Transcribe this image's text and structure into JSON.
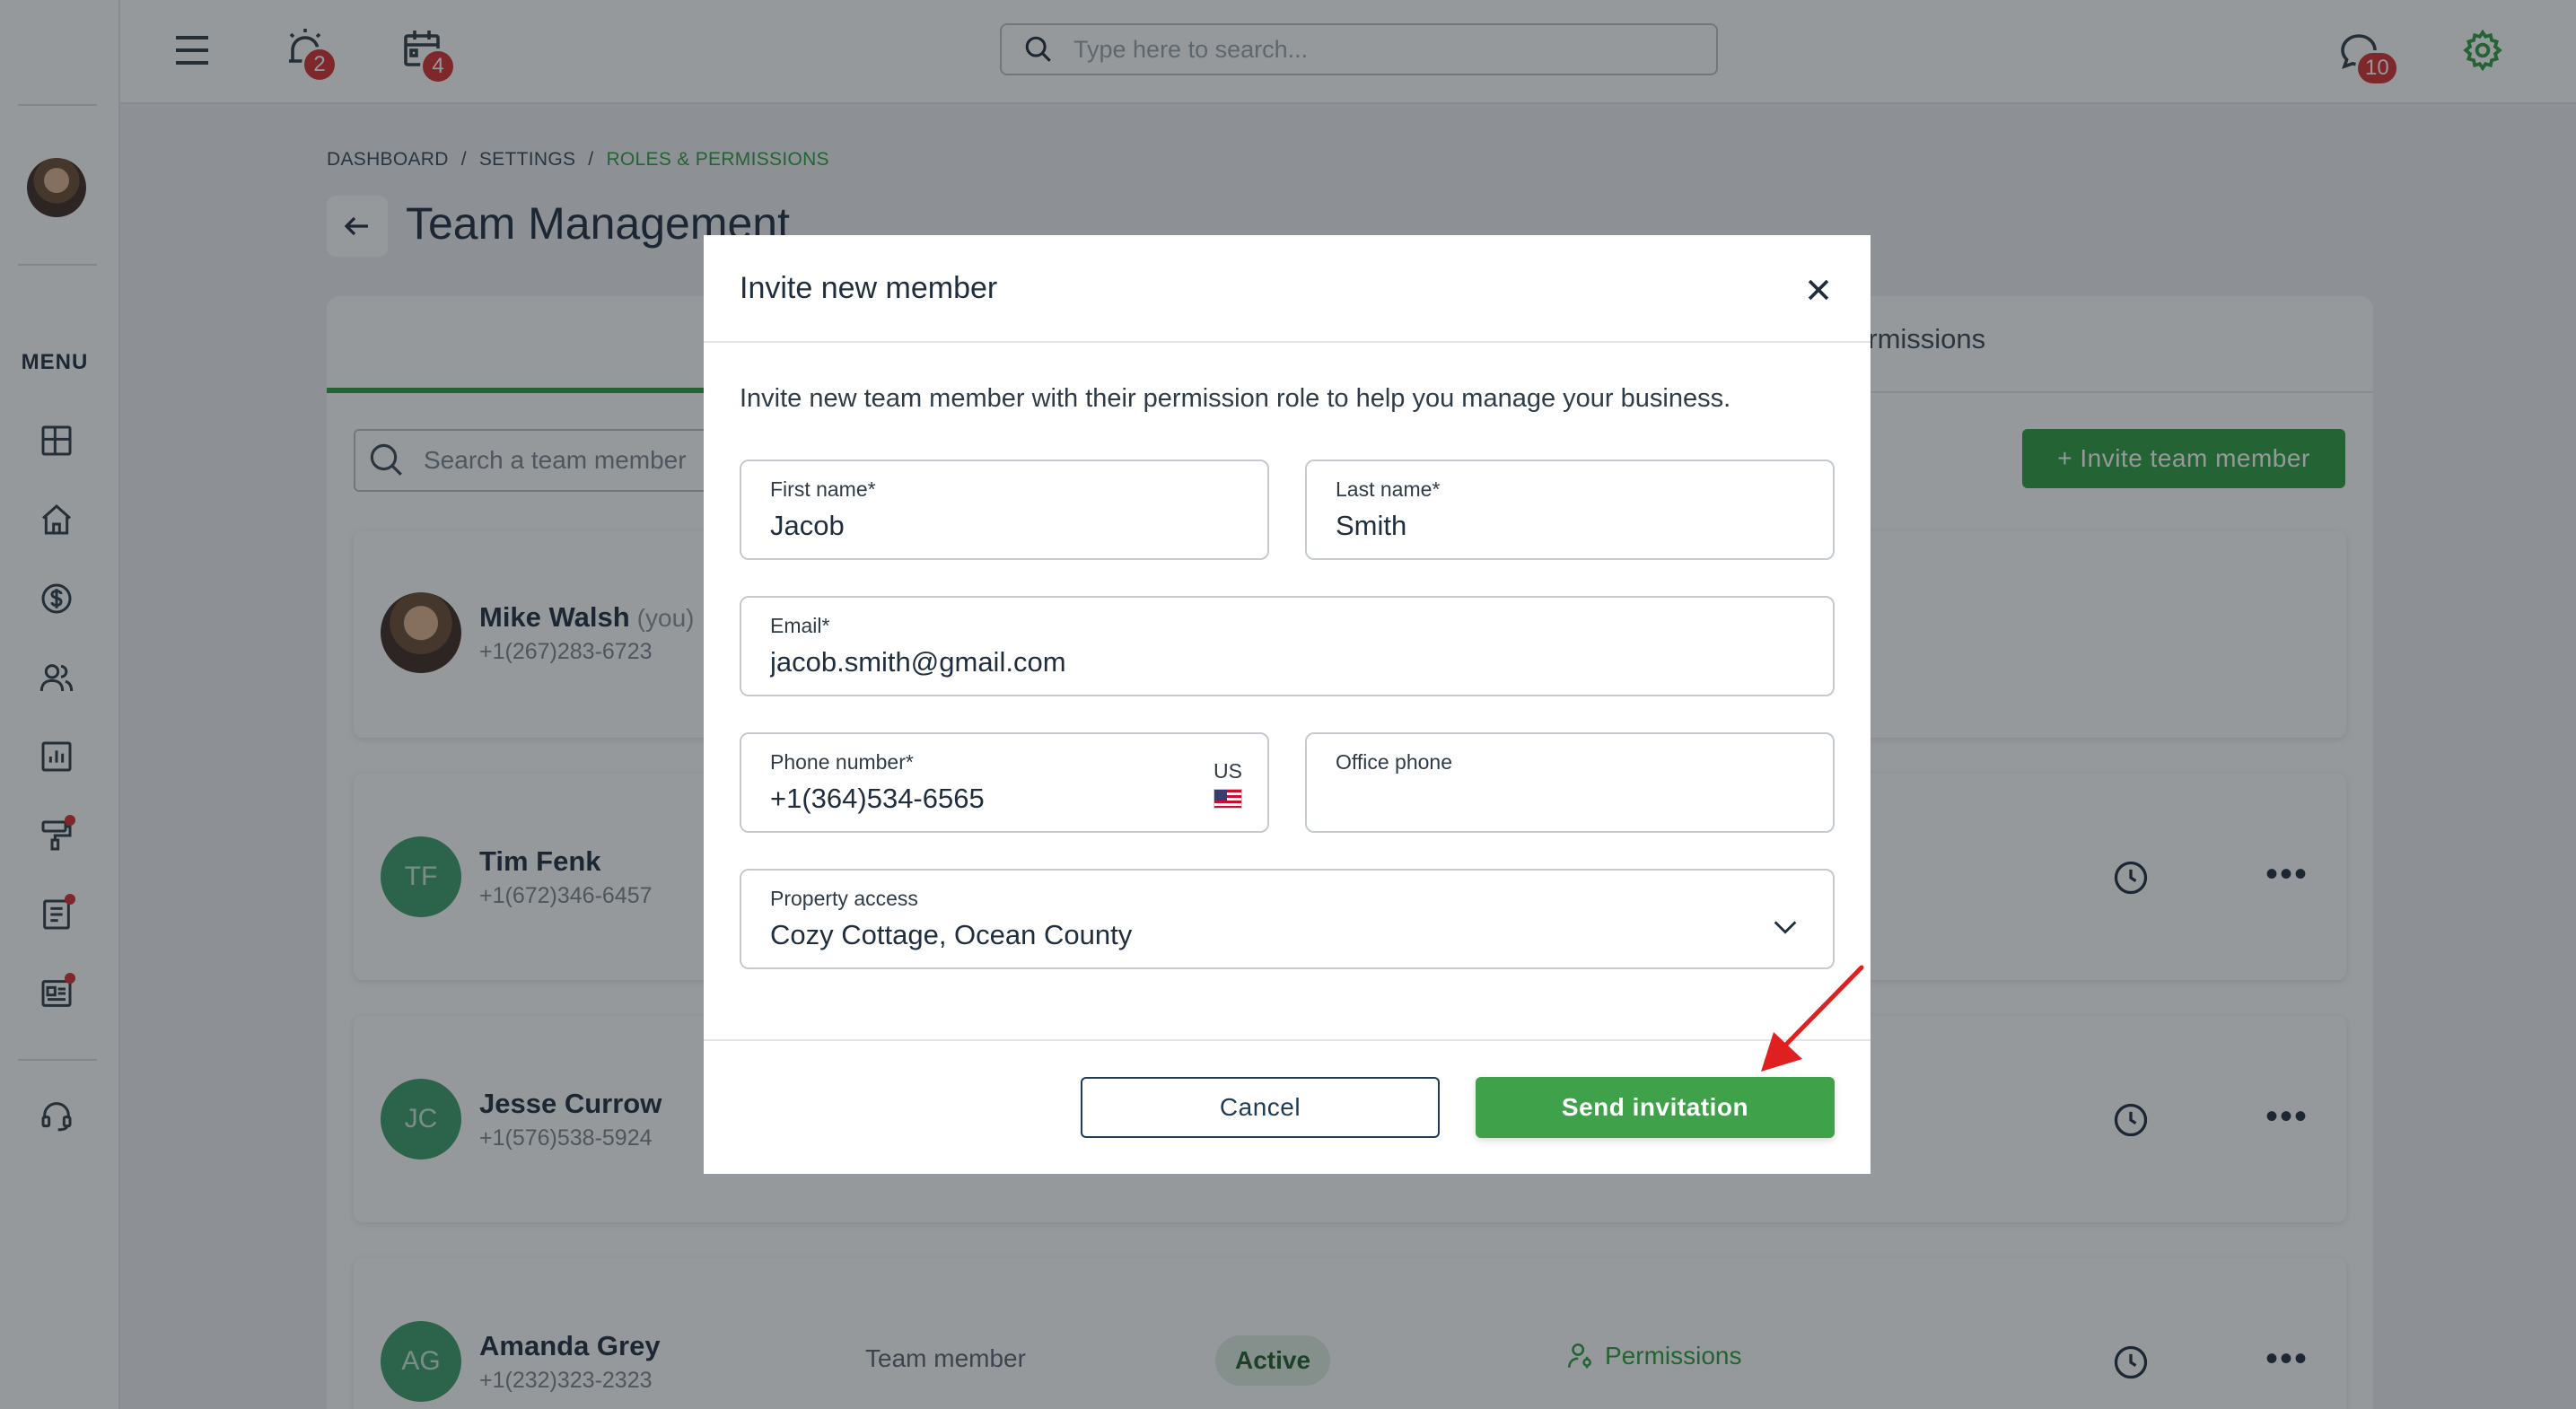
{
  "topbar": {
    "alerts_badge": "2",
    "calendar_badge": "4",
    "messages_badge": "10",
    "search_placeholder": "Type here to search..."
  },
  "sidebar": {
    "menu_label": "MENU",
    "items": [
      {
        "icon": "dashboard-icon"
      },
      {
        "icon": "home-icon"
      },
      {
        "icon": "dollar-icon"
      },
      {
        "icon": "users-icon"
      },
      {
        "icon": "reports-icon"
      },
      {
        "icon": "maintenance-icon",
        "notification_dot": true
      },
      {
        "icon": "document-icon",
        "notification_dot": true
      },
      {
        "icon": "listing-icon",
        "notification_dot": true
      },
      {
        "icon": "support-headset-icon"
      }
    ]
  },
  "breadcrumb": {
    "items": [
      "DASHBOARD",
      "SETTINGS",
      "ROLES & PERMISSIONS"
    ],
    "separator": "/"
  },
  "page": {
    "title": "Team Management",
    "tab_permissions_partial": "ermissions",
    "search_placeholder": "Search a team member",
    "invite_button": "+ Invite team member"
  },
  "members": [
    {
      "name": "Mike Walsh",
      "suffix": "(you)",
      "phone": "+1(267)283-6723",
      "initials": "",
      "photo": true
    },
    {
      "name": "Tim Fenk",
      "phone": "+1(672)346-6457",
      "initials": "TF"
    },
    {
      "name": "Jesse Currow",
      "phone": "+1(576)538-5924",
      "initials": "JC"
    },
    {
      "name": "Amanda Grey",
      "phone": "+1(232)323-2323",
      "initials": "AG",
      "role": "Team member",
      "status": "Active",
      "permissions_label": "Permissions"
    }
  ],
  "modal": {
    "title": "Invite new member",
    "description": "Invite new team member with their permission role to help you manage your business.",
    "fields": {
      "first_name": {
        "label": "First name*",
        "value": "Jacob"
      },
      "last_name": {
        "label": "Last name*",
        "value": "Smith"
      },
      "email": {
        "label": "Email*",
        "value": "jacob.smith@gmail.com"
      },
      "phone": {
        "label": "Phone number*",
        "value": "+1(364)534-6565",
        "country": "US"
      },
      "office_phone": {
        "label": "Office phone",
        "value": ""
      },
      "property_access": {
        "label": "Property access",
        "value": "Cozy Cottage, Ocean County"
      }
    },
    "cancel_label": "Cancel",
    "send_label": "Send invitation"
  },
  "colors": {
    "accent_green": "#2e9c3e",
    "badge_red": "#d32f2f",
    "annotation_arrow": "#e02020"
  }
}
